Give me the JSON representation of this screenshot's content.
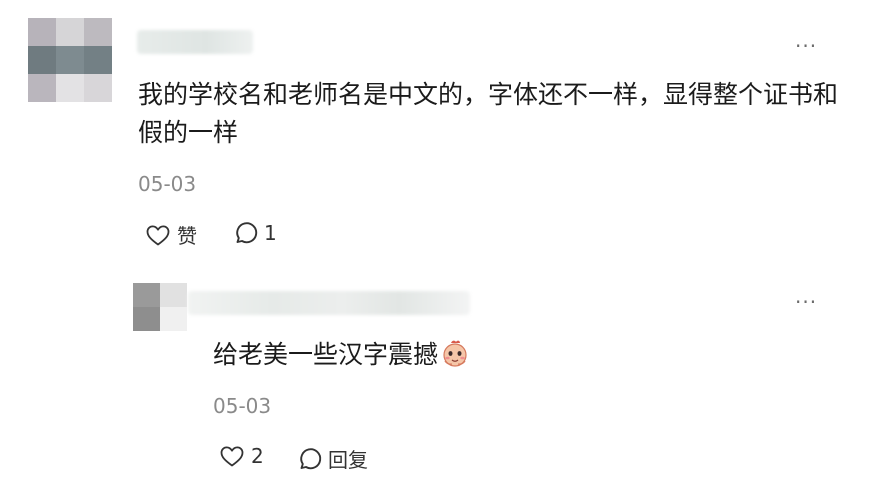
{
  "comment": {
    "text": "我的学校名和老师名是中文的，字体还不一样，显得整个证书和假的一样",
    "date": "05-03",
    "like_label": "赞",
    "comment_count": "1",
    "more_label": "···",
    "avatar_icon": "avatar-pixelated",
    "like_icon": "heart-outline-icon",
    "comment_icon": "speech-bubble-icon"
  },
  "reply": {
    "text": "给老美一些汉字震撼",
    "emoji_icon": "cute-character-emoji-icon",
    "date": "05-03",
    "like_count": "2",
    "reply_label": "回复",
    "more_label": "···",
    "avatar_icon": "avatar-pixelated",
    "like_icon": "heart-outline-icon",
    "reply_icon": "speech-bubble-icon"
  },
  "colors": {
    "text": "#1b1b1b",
    "meta": "#8a8a8a",
    "icon": "#333333",
    "background": "#ffffff"
  }
}
